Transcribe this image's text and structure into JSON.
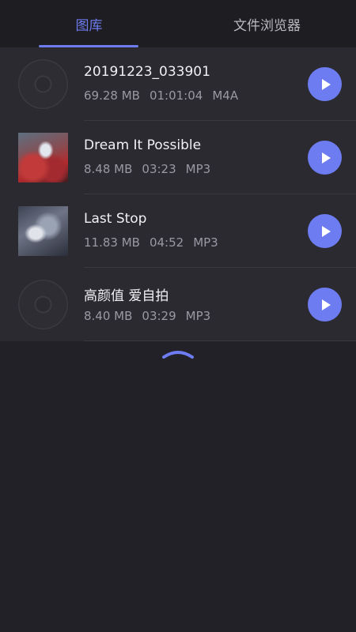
{
  "tabs": [
    {
      "label": "图库",
      "active": true
    },
    {
      "label": "文件浏览器",
      "active": false
    }
  ],
  "tracks": [
    {
      "title": "20191223_033901",
      "size": "69.28 MB",
      "duration": "01:01:04",
      "format": "M4A",
      "artwork": "disc-placeholder"
    },
    {
      "title": "Dream It Possible",
      "size": "8.48 MB",
      "duration": "03:23",
      "format": "MP3",
      "artwork": "album-art"
    },
    {
      "title": "Last Stop",
      "size": "11.83 MB",
      "duration": "04:52",
      "format": "MP3",
      "artwork": "album-art"
    },
    {
      "title": "高颜值 爱自拍",
      "size": "8.40 MB",
      "duration": "03:29",
      "format": "MP3",
      "artwork": "disc-placeholder"
    }
  ],
  "icons": {
    "play": "play-icon",
    "collapse": "chevron-up-icon"
  },
  "colors": {
    "accent": "#6d7cf0",
    "background": "#222128",
    "list_background": "#2b2a31",
    "tab_bar": "#1e1d22"
  }
}
